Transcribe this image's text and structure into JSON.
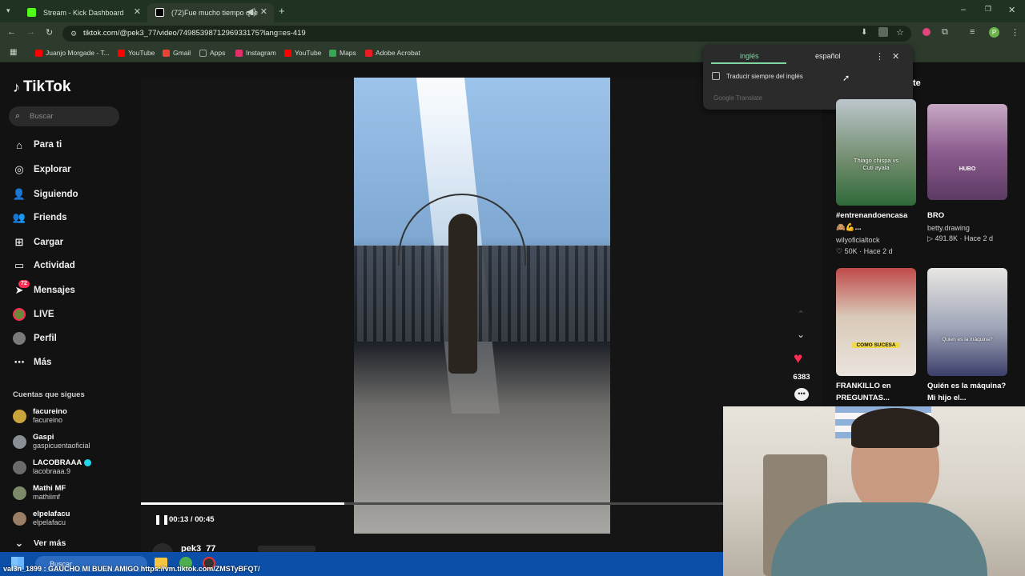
{
  "browser": {
    "tabs": [
      {
        "title": "Stream - Kick Dashboard",
        "icon": "kick-icon",
        "color": "#53fc18"
      },
      {
        "title": "(72)Fue mucho tiempo que",
        "icon": "tiktok-icon",
        "color": "#000000"
      }
    ],
    "url": "tiktok.com/@pek3_77/video/7498539871296933175?lang=es-419",
    "bookmarks": [
      {
        "label": "Juanjo Morgade - T...",
        "color": "#ff0000"
      },
      {
        "label": "YouTube",
        "color": "#ff0000"
      },
      {
        "label": "Gmail",
        "color": "#ea4335"
      },
      {
        "label": "Apps",
        "color": "#9aa0a6"
      },
      {
        "label": "Instagram",
        "color": "#e1306c"
      },
      {
        "label": "YouTube",
        "color": "#ff0000"
      },
      {
        "label": "Maps",
        "color": "#34a853"
      },
      {
        "label": "Adobe Acrobat",
        "color": "#ec1c24"
      }
    ]
  },
  "translate": {
    "lang_from": "inglés",
    "lang_to": "español",
    "checkbox_label": "Traducir siempre del inglés",
    "brand": "Google Translate"
  },
  "sidebar": {
    "logo": "TikTok",
    "search_placeholder": "Buscar",
    "nav": [
      {
        "label": "Para ti",
        "icon": "home-icon"
      },
      {
        "label": "Explorar",
        "icon": "compass-icon"
      },
      {
        "label": "Siguiendo",
        "icon": "following-icon"
      },
      {
        "label": "Friends",
        "icon": "friends-icon"
      },
      {
        "label": "Cargar",
        "icon": "upload-icon"
      },
      {
        "label": "Actividad",
        "icon": "activity-icon"
      },
      {
        "label": "Mensajes",
        "icon": "messages-icon",
        "badge": "72"
      },
      {
        "label": "LIVE",
        "icon": "live-icon"
      },
      {
        "label": "Perfil",
        "icon": "profile-icon"
      },
      {
        "label": "Más",
        "icon": "more-icon"
      }
    ],
    "following_title": "Cuentas que sigues",
    "accounts": [
      {
        "name": "facureino",
        "handle": "facureino",
        "color": "#c9a43a"
      },
      {
        "name": "Gaspi",
        "handle": "gaspicuentaoficial",
        "color": "#8a8f96"
      },
      {
        "name": "LACOBRAAA",
        "handle": "lacobraaa.9",
        "color": "#6b6b6b",
        "verified": true
      },
      {
        "name": "Mathi MF",
        "handle": "mathiimf",
        "color": "#7d8a6a"
      },
      {
        "name": "elpelafacu",
        "handle": "elpelafacu",
        "color": "#9a7e66"
      }
    ],
    "see_more": "Ver más"
  },
  "player": {
    "time": "00:13 / 00:45",
    "progress": 0.35,
    "likes": "6383",
    "author": "pek3_77"
  },
  "suggestions": [
    {
      "caption": "#entrenandoencasa 🙈💪...",
      "author": "wilyoficialtock",
      "stats": "50K · Hace 2 d",
      "overlay": "Thiago chispa vs Cuti ayala"
    },
    {
      "caption": "BRO",
      "author": "betty.drawing",
      "stats": "491.8K · Hace 2 d",
      "overlay": "HUBO"
    },
    {
      "caption": "FRANKILLO en PREGUNTAS...",
      "author": "",
      "stats": "",
      "overlay": "COMO SUCESA"
    },
    {
      "caption": "Quién es la máquina? Mi hijo el...",
      "author": "",
      "stats": "",
      "overlay": "Quien es la máquina?"
    }
  ],
  "suggestions_header_fragment": "te",
  "taskbar": {
    "search": "Buscar"
  },
  "chat_message": "val3n_1899 : GAUCHO MI BUEN AMIGO https://vm.tiktok.com/ZMSTyBFQT/"
}
